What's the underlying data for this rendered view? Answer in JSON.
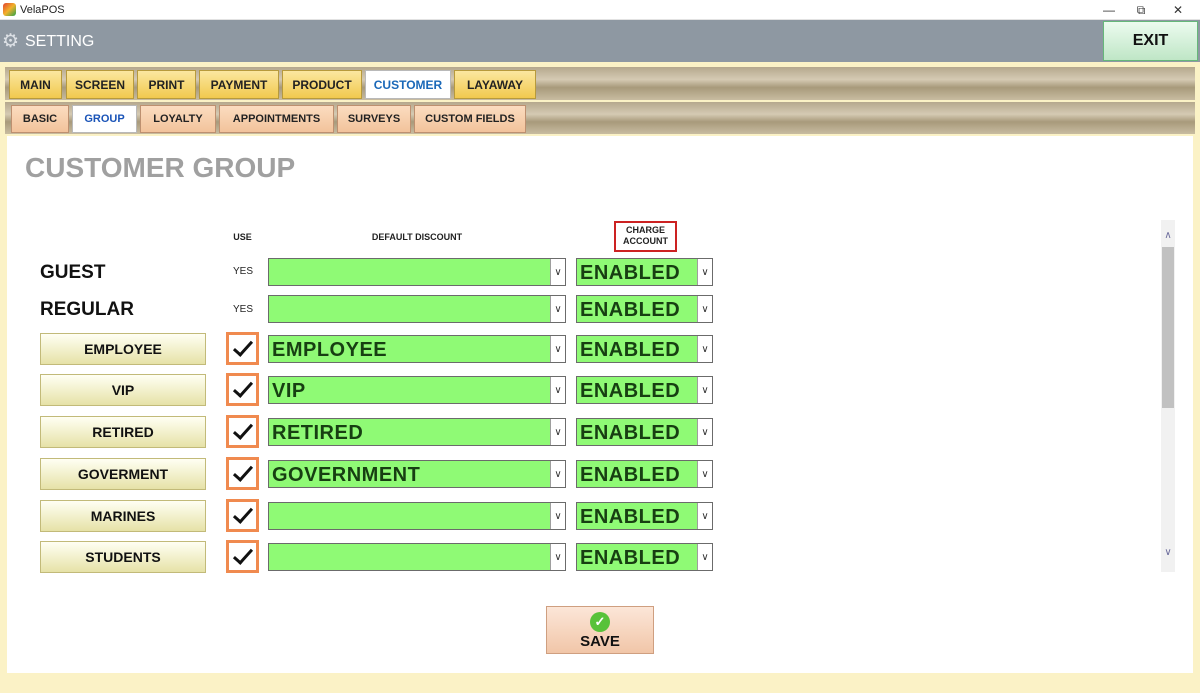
{
  "window": {
    "app_title": "VelaPOS"
  },
  "header": {
    "title": "SETTING",
    "exit_label": "EXIT"
  },
  "tabs": [
    "MAIN",
    "SCREEN",
    "PRINT",
    "PAYMENT",
    "PRODUCT",
    "CUSTOMER",
    "LAYAWAY"
  ],
  "active_tab": "CUSTOMER",
  "subtabs": [
    "BASIC",
    "GROUP",
    "LOYALTY",
    "APPOINTMENTS",
    "SURVEYS",
    "CUSTOM FIELDS"
  ],
  "active_subtab": "GROUP",
  "section_title": "CUSTOMER GROUP",
  "columns": {
    "use": "USE",
    "default_discount": "DEFAULT DISCOUNT",
    "charge_account_line1": "CHARGE",
    "charge_account_line2": "ACCOUNT"
  },
  "fixed_groups": [
    {
      "name": "GUEST",
      "use": "YES",
      "discount": "",
      "charge_account": "ENABLED"
    },
    {
      "name": "REGULAR",
      "use": "YES",
      "discount": "",
      "charge_account": "ENABLED"
    }
  ],
  "custom_groups": [
    {
      "name": "EMPLOYEE",
      "checked": true,
      "discount": "EMPLOYEE",
      "charge_account": "ENABLED"
    },
    {
      "name": "VIP",
      "checked": true,
      "discount": "VIP",
      "charge_account": "ENABLED"
    },
    {
      "name": "RETIRED",
      "checked": true,
      "discount": "RETIRED",
      "charge_account": "ENABLED"
    },
    {
      "name": "GOVERMENT",
      "checked": true,
      "discount": "GOVERNMENT",
      "charge_account": "ENABLED"
    },
    {
      "name": "MARINES",
      "checked": true,
      "discount": "",
      "charge_account": "ENABLED"
    },
    {
      "name": "STUDENTS",
      "checked": true,
      "discount": "",
      "charge_account": "ENABLED"
    }
  ],
  "save_label": "SAVE",
  "colors": {
    "dropdown_bg": "#8ffa75",
    "tab_gold": "#f1c94e",
    "subtab_peach": "#f2c39b",
    "checkbox_orange": "#f08a4f",
    "charge_header_border": "#cc2222",
    "active_tab_text": "#1a68b8"
  },
  "icons": {
    "app": "velapos-logo-icon",
    "settings": "gear-icon",
    "save": "checkmark-circle-icon",
    "dropdown": "chevron-down-icon"
  }
}
